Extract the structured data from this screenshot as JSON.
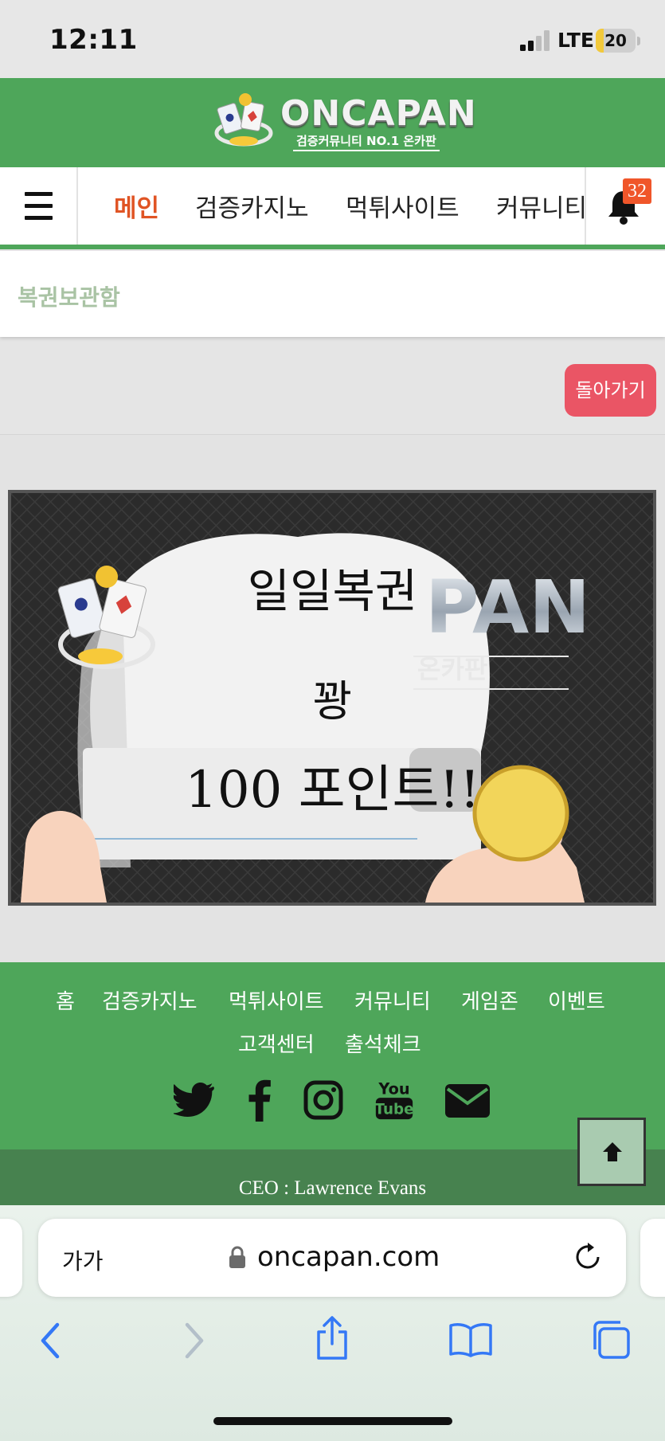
{
  "status_bar": {
    "time": "12:11",
    "network": "LTE",
    "battery_level": "20",
    "battery_fraction": 0.2
  },
  "header": {
    "logo_text": "ONCAPAN",
    "logo_subtitle": "검증커뮤니티 NO.1 온카판"
  },
  "nav": {
    "items": [
      "메인",
      "검증카지노",
      "먹튀사이트",
      "커뮤니티"
    ],
    "active_index": 0,
    "notification_count": "32"
  },
  "page": {
    "title": "복권보관함",
    "back_label": "돌아가기"
  },
  "lottery_card": {
    "line1": "일일복권",
    "line2": "꽝",
    "line3": "100 포인트!!",
    "watermark": "PAN",
    "watermark_sub": "온카판"
  },
  "footer": {
    "links_row1": [
      "홈",
      "검증카지노",
      "먹튀사이트",
      "커뮤니티",
      "게임존",
      "이벤트"
    ],
    "links_row2": [
      "고객센터",
      "출석체크"
    ],
    "social_icons": [
      "twitter-icon",
      "facebook-icon",
      "instagram-icon",
      "youtube-icon",
      "mail-icon"
    ],
    "ceo": "CEO : Lawrence Evans"
  },
  "browser": {
    "text_size_label": "가가",
    "url": "oncapan.com"
  },
  "colors": {
    "brand_green": "#4ea65a",
    "footer_dark_green": "#47824f",
    "nav_active": "#e05424",
    "back_button": "#ea5565",
    "badge": "#f0562a",
    "ios_blue": "#3478f6"
  }
}
